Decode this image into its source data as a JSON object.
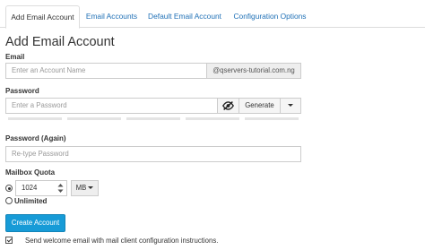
{
  "tabs": [
    {
      "label": "Add Email Account"
    },
    {
      "label": "Email Accounts"
    },
    {
      "label": "Default Email Account"
    },
    {
      "label": "Configuration Options"
    }
  ],
  "page_title": "Add Email Account",
  "email": {
    "label": "Email",
    "placeholder": "Enter an Account Name",
    "domain": "@qservers-tutorial.com.ng"
  },
  "password": {
    "label": "Password",
    "placeholder": "Enter a Password",
    "generate_label": "Generate"
  },
  "password_again": {
    "label": "Password (Again)",
    "placeholder": "Re-type Password"
  },
  "quota": {
    "label": "Mailbox Quota",
    "value": "1024",
    "unit": "MB",
    "unlimited_label": "Unlimited"
  },
  "create_label": "Create Account",
  "welcome_email_label": "Send welcome email with mail client configuration instructions.",
  "colors": {
    "link": "#1f70b6",
    "primary_button": "#179bd7"
  }
}
